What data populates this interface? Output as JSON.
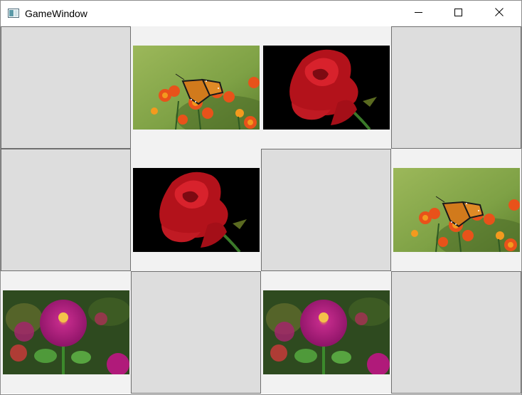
{
  "window": {
    "title": "GameWindow"
  },
  "controls": {
    "minimize_icon": "minimize-icon",
    "maximize_icon": "maximize-icon",
    "close_icon": "close-icon"
  },
  "board": {
    "rows": 3,
    "cols": 4,
    "cards": [
      {
        "row": 0,
        "col": 0,
        "state": "hidden",
        "image": ""
      },
      {
        "row": 0,
        "col": 1,
        "state": "revealed",
        "image": "butterfly-marigold"
      },
      {
        "row": 0,
        "col": 2,
        "state": "revealed",
        "image": "red-rose"
      },
      {
        "row": 0,
        "col": 3,
        "state": "hidden",
        "image": ""
      },
      {
        "row": 1,
        "col": 0,
        "state": "hidden",
        "image": ""
      },
      {
        "row": 1,
        "col": 1,
        "state": "revealed",
        "image": "red-rose"
      },
      {
        "row": 1,
        "col": 2,
        "state": "hidden",
        "image": ""
      },
      {
        "row": 1,
        "col": 3,
        "state": "revealed",
        "image": "butterfly-marigold"
      },
      {
        "row": 2,
        "col": 0,
        "state": "revealed",
        "image": "pink-zinnia"
      },
      {
        "row": 2,
        "col": 1,
        "state": "hidden",
        "image": ""
      },
      {
        "row": 2,
        "col": 2,
        "state": "revealed",
        "image": "pink-zinnia"
      },
      {
        "row": 2,
        "col": 3,
        "state": "hidden",
        "image": ""
      }
    ]
  },
  "colors": {
    "card_back": "#dddddd",
    "card_face": "#f2f2f2",
    "card_border": "#6f6f6f"
  }
}
